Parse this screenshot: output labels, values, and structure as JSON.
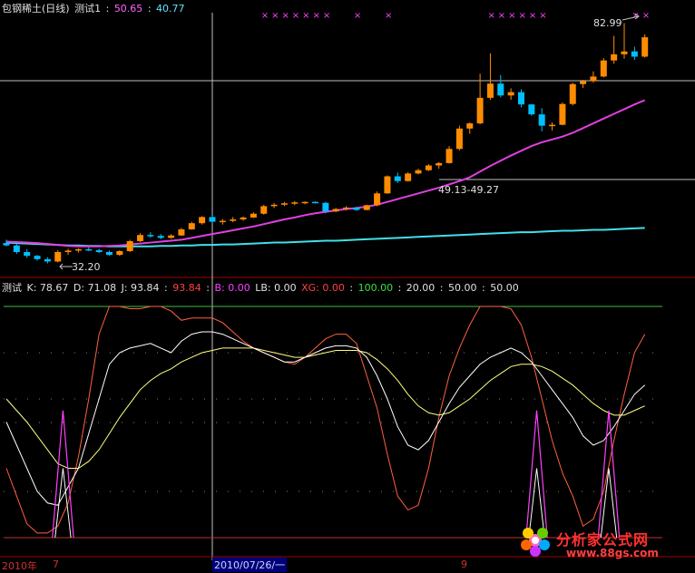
{
  "header": {
    "stock": "包钢稀土(日线)",
    "indicator": "测试1",
    "sep1": ":",
    "val1": "50.65",
    "sep2": ":",
    "val2": "40.77"
  },
  "annotations": {
    "high": "82.99",
    "low": "32.20",
    "mid": "49.13-49.27"
  },
  "sub_header": {
    "name": "测试",
    "k": "K: 78.67",
    "d": "D: 71.08",
    "j": "J: 93.84",
    "colon1": ":",
    "v_red": "93.84",
    "colon2": ":",
    "b": "B: 0.00",
    "lb": "LB: 0.00",
    "xg": "XG: 0.00",
    "colon3": ":",
    "v_green": "100.00",
    "colon4": ":",
    "v20": "20.00",
    "colon5": ":",
    "v50a": "50.00",
    "colon6": ":",
    "v50b": "50.00"
  },
  "x_axis": {
    "year": "2010年",
    "mark7": "7",
    "date": "2010/07/26/一",
    "mark9": "9"
  },
  "watermark": {
    "brand": "分析家公式网",
    "url": "www.88gs.com"
  },
  "colors": {
    "up": "#ff8c00",
    "down": "#00bfff",
    "ma1": "#e040e0",
    "ma2": "#40e0e8",
    "k": "#ffffff",
    "d": "#ffff80",
    "j": "#ff6040",
    "signal": "#ff40ff"
  },
  "chart_data": {
    "type": "candlestick",
    "price_axis": {
      "high_label": 82.99,
      "low_label": 32.2,
      "mid_range": [
        49.13,
        49.27
      ]
    },
    "candles": [
      [
        36.5,
        37.2,
        35.8,
        36.0
      ],
      [
        36.0,
        36.4,
        34.2,
        34.6
      ],
      [
        34.6,
        35.2,
        33.4,
        33.8
      ],
      [
        33.8,
        34.0,
        32.8,
        33.1
      ],
      [
        33.1,
        33.5,
        32.2,
        32.6
      ],
      [
        32.6,
        35.0,
        32.4,
        34.6
      ],
      [
        34.6,
        35.3,
        34.0,
        34.9
      ],
      [
        34.9,
        35.4,
        34.5,
        35.2
      ],
      [
        35.2,
        35.6,
        34.8,
        35.0
      ],
      [
        35.0,
        35.3,
        34.4,
        34.6
      ],
      [
        34.6,
        34.9,
        33.8,
        34.0
      ],
      [
        34.0,
        35.0,
        33.8,
        34.8
      ],
      [
        34.8,
        37.2,
        34.6,
        36.9
      ],
      [
        36.9,
        38.6,
        36.7,
        38.2
      ],
      [
        38.2,
        38.8,
        37.6,
        38.0
      ],
      [
        38.0,
        38.4,
        37.3,
        37.6
      ],
      [
        37.6,
        38.4,
        37.4,
        38.1
      ],
      [
        38.1,
        39.7,
        38.0,
        39.4
      ],
      [
        39.4,
        41.0,
        39.3,
        40.7
      ],
      [
        40.7,
        42.2,
        40.4,
        42.0
      ],
      [
        42.0,
        42.3,
        40.8,
        41.0
      ],
      [
        41.0,
        41.6,
        40.4,
        41.2
      ],
      [
        41.2,
        42.0,
        40.9,
        41.5
      ],
      [
        41.5,
        42.1,
        41.2,
        41.9
      ],
      [
        41.9,
        43.0,
        41.8,
        42.7
      ],
      [
        42.7,
        44.6,
        42.5,
        44.3
      ],
      [
        44.3,
        45.0,
        43.9,
        44.6
      ],
      [
        44.6,
        45.2,
        44.3,
        44.9
      ],
      [
        44.9,
        45.4,
        44.5,
        45.1
      ],
      [
        45.1,
        45.3,
        44.7,
        45.2
      ],
      [
        45.2,
        45.3,
        44.9,
        45.0
      ],
      [
        45.0,
        45.2,
        42.8,
        43.2
      ],
      [
        43.2,
        43.9,
        43.0,
        43.7
      ],
      [
        43.7,
        44.3,
        43.4,
        44.0
      ],
      [
        44.0,
        44.2,
        43.3,
        43.5
      ],
      [
        43.5,
        44.6,
        43.4,
        44.5
      ],
      [
        44.5,
        47.4,
        44.3,
        47.0
      ],
      [
        47.0,
        50.8,
        46.9,
        50.6
      ],
      [
        50.6,
        51.4,
        49.2,
        49.6
      ],
      [
        49.6,
        51.5,
        49.5,
        51.2
      ],
      [
        51.2,
        52.2,
        51.0,
        51.9
      ],
      [
        51.9,
        53.2,
        51.7,
        52.9
      ],
      [
        52.9,
        53.6,
        52.2,
        53.4
      ],
      [
        53.4,
        57.0,
        53.3,
        56.4
      ],
      [
        56.4,
        61.3,
        56.1,
        60.7
      ],
      [
        60.7,
        62.0,
        59.6,
        61.8
      ],
      [
        61.8,
        72.3,
        61.6,
        67.2
      ],
      [
        67.2,
        76.6,
        66.8,
        70.2
      ],
      [
        70.2,
        72.0,
        67.3,
        67.7
      ],
      [
        67.7,
        69.2,
        66.8,
        68.4
      ],
      [
        68.4,
        69.0,
        65.2,
        65.8
      ],
      [
        65.8,
        65.9,
        63.4,
        63.7
      ],
      [
        63.7,
        65.0,
        60.1,
        61.3
      ],
      [
        61.3,
        62.0,
        60.3,
        61.5
      ],
      [
        61.5,
        66.2,
        61.4,
        65.9
      ],
      [
        65.9,
        70.4,
        65.6,
        70.1
      ],
      [
        70.1,
        71.0,
        69.3,
        70.7
      ],
      [
        70.7,
        72.8,
        70.4,
        71.7
      ],
      [
        71.7,
        75.6,
        71.5,
        75.1
      ],
      [
        75.1,
        80.3,
        74.4,
        76.4
      ],
      [
        76.4,
        82.99,
        75.5,
        77.0
      ],
      [
        77.0,
        78.0,
        75.2,
        75.9
      ],
      [
        75.9,
        80.6,
        75.7,
        80.0
      ]
    ],
    "ma_slow": [
      36.8,
      36.7,
      36.6,
      36.5,
      36.3,
      36.1,
      35.9,
      35.8,
      35.8,
      35.8,
      35.9,
      36.0,
      36.2,
      36.4,
      36.6,
      36.8,
      37.0,
      37.2,
      37.6,
      38.0,
      38.4,
      38.8,
      39.2,
      39.6,
      40.0,
      40.5,
      41.0,
      41.5,
      41.9,
      42.4,
      42.8,
      43.1,
      43.4,
      43.7,
      43.9,
      44.2,
      44.6,
      45.2,
      45.8,
      46.4,
      47.0,
      47.6,
      48.2,
      48.9,
      49.6,
      50.4,
      51.6,
      52.8,
      53.9,
      55.0,
      56.0,
      57.0,
      57.8,
      58.4,
      59.0,
      59.8,
      60.8,
      61.8,
      62.8,
      63.8,
      64.8,
      65.8,
      66.7
    ],
    "ma_long": [
      36.6,
      36.5,
      36.4,
      36.3,
      36.2,
      36.1,
      36.0,
      36.0,
      35.9,
      35.9,
      35.8,
      35.8,
      35.8,
      35.8,
      35.8,
      35.9,
      35.9,
      36.0,
      36.0,
      36.1,
      36.1,
      36.2,
      36.2,
      36.3,
      36.4,
      36.5,
      36.6,
      36.6,
      36.7,
      36.8,
      36.9,
      37.0,
      37.0,
      37.1,
      37.2,
      37.3,
      37.4,
      37.5,
      37.6,
      37.7,
      37.8,
      37.9,
      38.0,
      38.1,
      38.2,
      38.3,
      38.4,
      38.5,
      38.6,
      38.7,
      38.8,
      38.8,
      38.9,
      39.0,
      39.1,
      39.1,
      39.2,
      39.3,
      39.3,
      39.4,
      39.5,
      39.6,
      39.7
    ],
    "kdj": {
      "levels": [
        20,
        50,
        50,
        100
      ],
      "ylim": [
        0,
        100
      ],
      "K": [
        50,
        40,
        30,
        20,
        15,
        14,
        22,
        30,
        45,
        60,
        75,
        80,
        82,
        83,
        84,
        82,
        80,
        85,
        88,
        89,
        89,
        88,
        86,
        84,
        82,
        80,
        78,
        76,
        76,
        78,
        80,
        82,
        83,
        83,
        82,
        78,
        70,
        60,
        48,
        40,
        38,
        42,
        50,
        58,
        65,
        70,
        75,
        78,
        80,
        82,
        80,
        76,
        70,
        64,
        58,
        52,
        44,
        40,
        42,
        48,
        55,
        62,
        66
      ],
      "D": [
        60,
        55,
        50,
        44,
        38,
        32,
        30,
        30,
        33,
        38,
        45,
        52,
        58,
        64,
        68,
        71,
        73,
        76,
        78,
        80,
        81,
        82,
        82,
        82,
        82,
        81,
        80,
        79,
        78,
        78,
        79,
        80,
        81,
        81,
        81,
        80,
        77,
        73,
        68,
        62,
        57,
        54,
        53,
        54,
        57,
        60,
        64,
        68,
        71,
        74,
        75,
        75,
        74,
        72,
        69,
        66,
        62,
        58,
        55,
        53,
        53,
        55,
        57
      ],
      "J": [
        30,
        18,
        6,
        2,
        2,
        5,
        15,
        35,
        60,
        88,
        100,
        100,
        99,
        99,
        100,
        100,
        98,
        94,
        95,
        95,
        95,
        93,
        89,
        85,
        82,
        80,
        78,
        76,
        75,
        78,
        82,
        86,
        88,
        88,
        84,
        70,
        56,
        36,
        18,
        12,
        14,
        30,
        52,
        70,
        82,
        92,
        100,
        100,
        100,
        99,
        92,
        78,
        60,
        42,
        28,
        18,
        5,
        8,
        20,
        42,
        62,
        80,
        88
      ],
      "signals": [
        5,
        6,
        51,
        52,
        58,
        59
      ]
    }
  }
}
